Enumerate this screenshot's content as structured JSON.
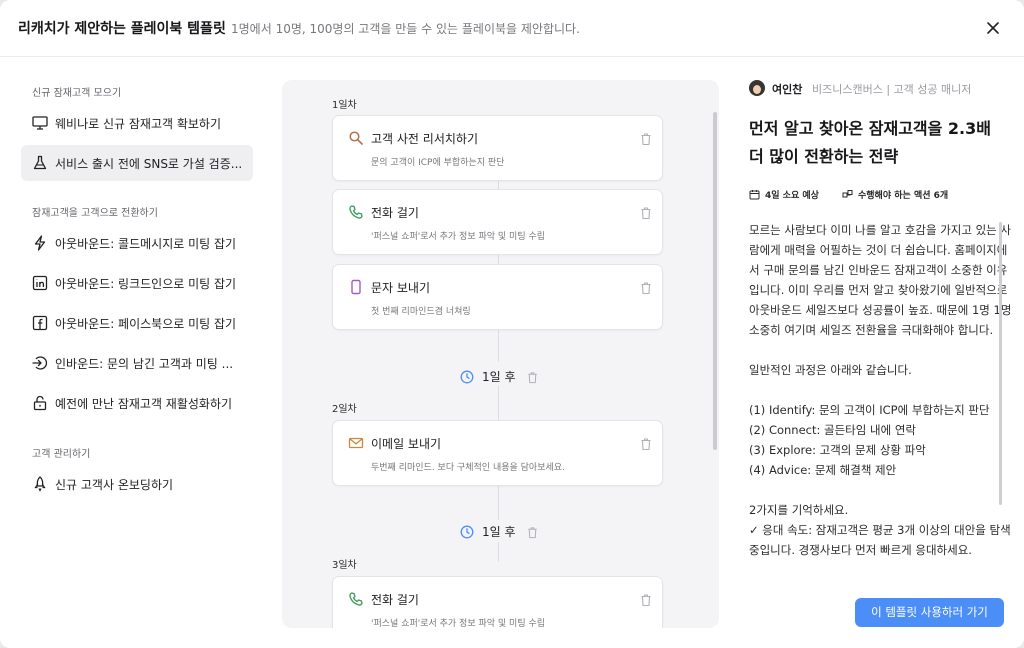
{
  "header": {
    "title": "리캐치가 제안하는 플레이북 템플릿",
    "subtitle": "1명에서 10명, 100명의 고객을 만들 수 있는 플레이북을 제안합니다."
  },
  "sidebar": {
    "sections": [
      {
        "title": "신규 잠재고객 모으기",
        "items": [
          {
            "label": "웨비나로 신규 잠재고객 확보하기",
            "icon": "monitor-icon"
          },
          {
            "label": "서비스 출시 전에 SNS로 가설 검증...",
            "icon": "flask-icon",
            "active": true
          }
        ]
      },
      {
        "title": "잠재고객을 고객으로 전환하기",
        "items": [
          {
            "label": "아웃바운드: 콜드메시지로 미팅 잡기",
            "icon": "lightning-icon"
          },
          {
            "label": "아웃바운드: 링크드인으로 미팅 잡기",
            "icon": "linkedin-icon"
          },
          {
            "label": "아웃바운드: 페이스북으로 미팅 잡기",
            "icon": "facebook-icon"
          },
          {
            "label": "인바운드: 문의 남긴 고객과 미팅 ...",
            "icon": "login-icon"
          },
          {
            "label": "예전에 만난 잠재고객 재활성화하기",
            "icon": "unlock-icon"
          }
        ]
      },
      {
        "title": "고객 관리하기",
        "items": [
          {
            "label": "신규 고객사 온보딩하기",
            "icon": "rocket-icon"
          }
        ]
      }
    ]
  },
  "timeline": {
    "days": [
      {
        "label": "1일차",
        "steps": [
          {
            "title": "고객 사전 리서치하기",
            "desc": "문의 고객이 ICP에 부합하는지 판단",
            "icon": "search-icon",
            "color": "#b5704a"
          },
          {
            "title": "전화 걸기",
            "desc": "'퍼스널 쇼퍼'로서 추가 정보 파악 및 미팅 수립",
            "icon": "phone-icon",
            "color": "#3f9a5a"
          },
          {
            "title": "문자 보내기",
            "desc": "첫 번째 리마인드겸 너쳐링",
            "icon": "mobile-icon",
            "color": "#a35bc4"
          }
        ]
      },
      {
        "label": "2일차",
        "steps": [
          {
            "title": "이메일 보내기",
            "desc": "두번째 리마인드. 보다 구체적인 내용을 담아보세요.",
            "icon": "mail-icon",
            "color": "#c58a3c"
          }
        ]
      },
      {
        "label": "3일차",
        "steps": [
          {
            "title": "전화 걸기",
            "desc": "'퍼스널 쇼퍼'로서 추가 정보 파악 및 미팅 수립",
            "icon": "phone-icon",
            "color": "#3f9a5a"
          }
        ]
      }
    ],
    "delays": [
      "1일 후",
      "1일 후"
    ],
    "accent": "#4c8ef7"
  },
  "detail": {
    "author_name": "여인찬",
    "author_role": "비즈니스캔버스 | 고객 성공 매니저",
    "title": "먼저 알고 찾아온 잠재고객을 2.3배 더 많이 전환하는 전략",
    "meta_duration": "4일 소요 예상",
    "meta_actions": "수행해야 하는 액션 6개",
    "paragraphs": [
      "모르는 사람보다 이미 나를 알고 호감을 가지고 있는 사람에게 매력을 어필하는 것이 더 쉽습니다. 홈페이지에서 구매 문의를 남긴 인바운드 잠재고객이 소중한 이유입니다. 이미 우리를 먼저 알고 찾아왔기에 일반적으로 아웃바운드 세일즈보다 성공률이 높죠. 때문에 1명 1명 소중히 여기며 세일즈 전환율을 극대화해야 합니다.",
      "일반적인 과정은 아래와 같습니다.",
      "(1) Identify: 문의 고객이 ICP에 부합하는지 판단\n(2) Connect: 골든타임 내에 연락\n(3) Explore: 고객의 문제 상황 파악\n(4) Advice: 문제 해결책 제안",
      "2가지를 기억하세요.\n✓ 응대 속도: 잠재고객은 평균 3개 이상의 대안을 탐색 중입니다. 경쟁사보다 먼저 빠르게 응대하세요."
    ],
    "cta_label": "이 템플릿 사용하러 가기",
    "cta_color": "#4c8ef7"
  }
}
